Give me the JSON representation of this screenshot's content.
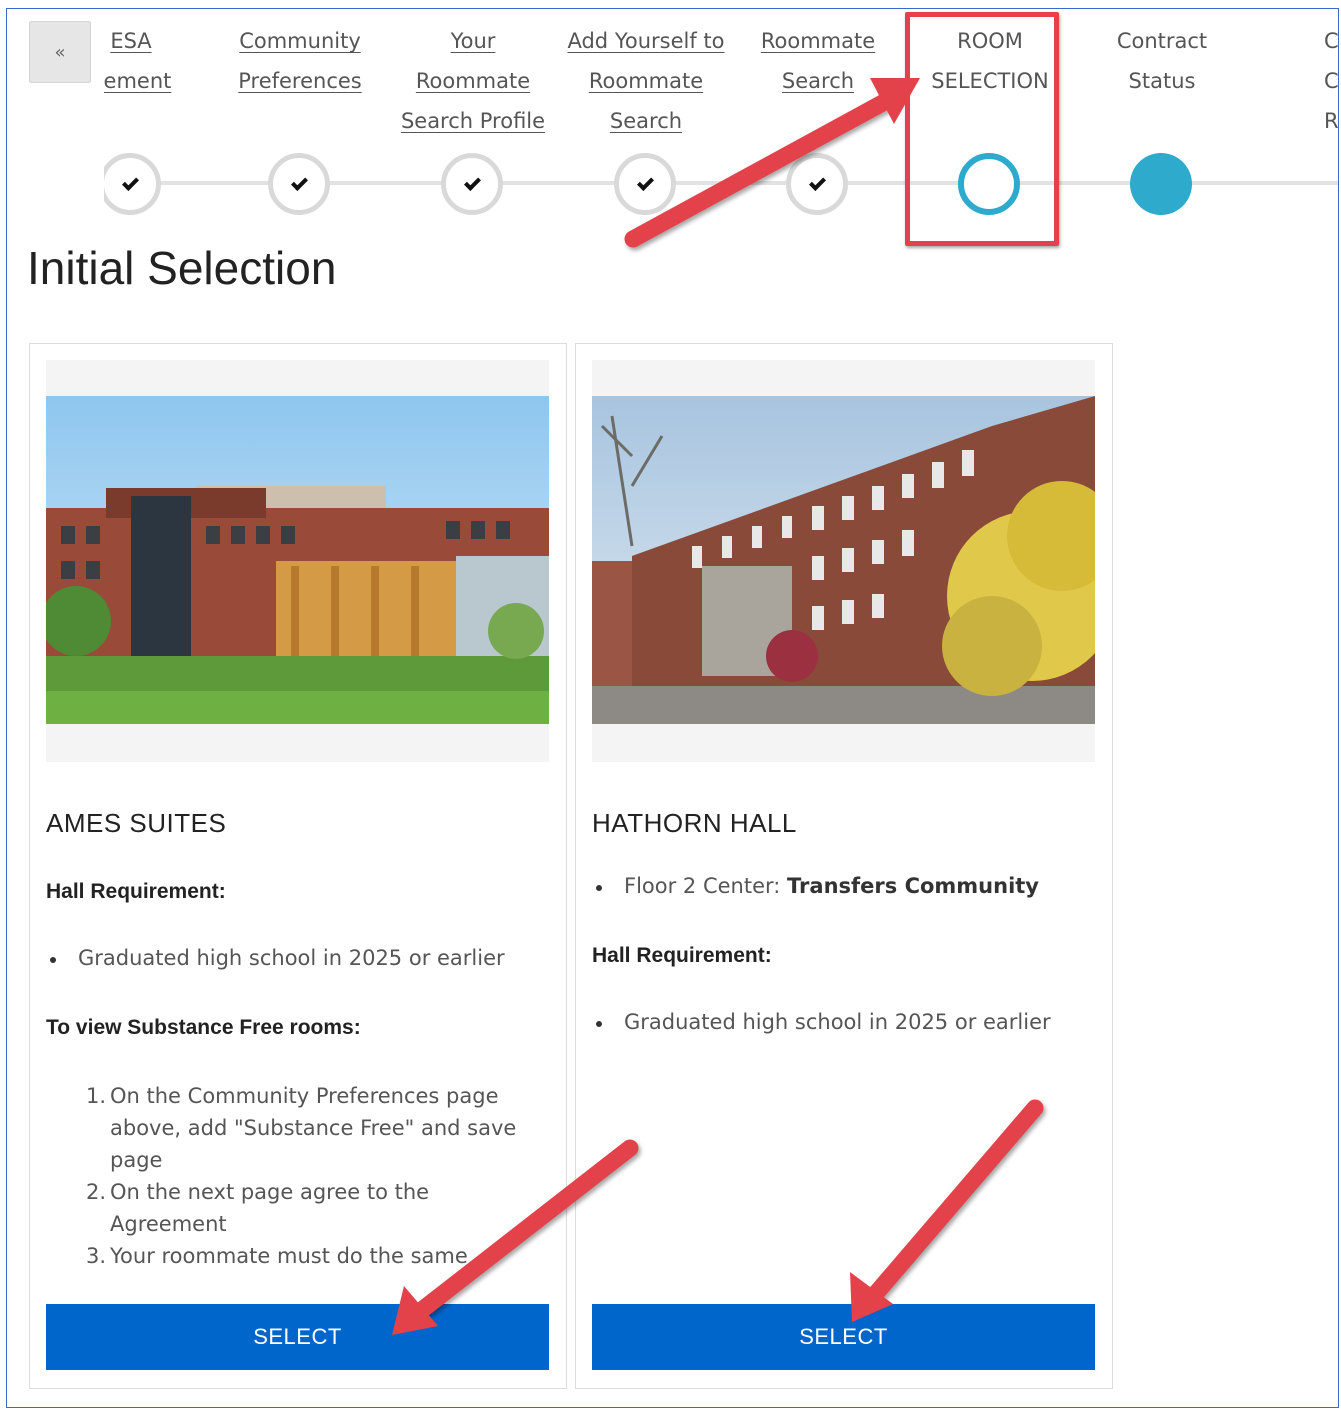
{
  "stepper": {
    "collapse_label": "«",
    "steps": [
      {
        "lines": [
          "ESA",
          "eement"
        ],
        "state": "done",
        "link": true
      },
      {
        "lines": [
          "Community",
          "Preferences"
        ],
        "state": "done",
        "link": true
      },
      {
        "lines": [
          "Your",
          "Roommate",
          "Search Profile"
        ],
        "state": "done",
        "link": true
      },
      {
        "lines": [
          "Add Yourself to",
          "Roommate",
          "Search"
        ],
        "state": "done",
        "link": true
      },
      {
        "lines": [
          "Roommate",
          "Search"
        ],
        "state": "done",
        "link": true
      },
      {
        "lines": [
          "ROOM",
          "SELECTION"
        ],
        "state": "current",
        "link": false
      },
      {
        "lines": [
          "Contract",
          "Status"
        ],
        "state": "future",
        "link": false
      },
      {
        "lines": [
          "Canc",
          "Contr",
          "Requ"
        ],
        "state": "future",
        "link": false
      }
    ]
  },
  "page": {
    "title": "Initial Selection"
  },
  "cards": [
    {
      "name": "AMES SUITES",
      "hall_requirement_heading": "Hall Requirement:",
      "hall_requirement": "Graduated high school in 2025 or earlier",
      "substance_heading": "To view Substance Free rooms:",
      "substance_steps": [
        {
          "num": "1.",
          "text": "On the Community Preferences page above, add \"Substance Free\" and save page"
        },
        {
          "num": "2.",
          "text": "On the next page agree to the Agreement"
        },
        {
          "num": "3.",
          "text": "Your roommate must do the same"
        }
      ],
      "button_label": "SELECT"
    },
    {
      "name": "HATHORN HALL",
      "community_prefix": "Floor 2 Center: ",
      "community_name": "Transfers Community",
      "hall_requirement_heading": "Hall Requirement:",
      "hall_requirement": "Graduated high school in 2025 or earlier",
      "button_label": "SELECT"
    }
  ],
  "colors": {
    "primary_button": "#0066cc",
    "stepper_accent": "#2eaacc",
    "annotation_red": "#e4424a"
  }
}
